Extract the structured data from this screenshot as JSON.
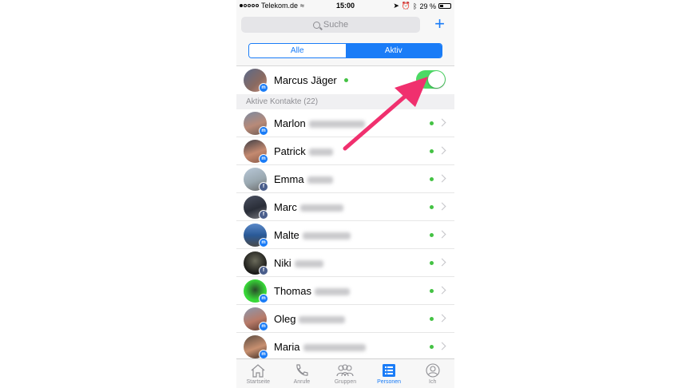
{
  "status_bar": {
    "carrier": "Telekom.de",
    "time": "15:00",
    "battery": "29 %"
  },
  "search": {
    "placeholder": "Suche"
  },
  "segments": {
    "all": "Alle",
    "active": "Aktiv"
  },
  "own_profile": {
    "name": "Marcus Jäger",
    "active_toggle_on": true
  },
  "section_header": "Aktive Kontakte (22)",
  "contacts": [
    {
      "first_name": "Marlon",
      "badge": "messenger-icon"
    },
    {
      "first_name": "Patrick",
      "badge": "messenger-icon"
    },
    {
      "first_name": "Emma",
      "badge": "facebook-icon"
    },
    {
      "first_name": "Marc",
      "badge": "facebook-icon"
    },
    {
      "first_name": "Malte",
      "badge": "messenger-icon"
    },
    {
      "first_name": "Niki",
      "badge": "facebook-icon"
    },
    {
      "first_name": "Thomas",
      "badge": "messenger-icon"
    },
    {
      "first_name": "Oleg",
      "badge": "messenger-icon"
    },
    {
      "first_name": "Maria",
      "badge": "messenger-icon"
    }
  ],
  "tabs": [
    {
      "label": "Startseite",
      "icon": "home-icon"
    },
    {
      "label": "Anrufe",
      "icon": "phone-icon"
    },
    {
      "label": "Gruppen",
      "icon": "groups-icon"
    },
    {
      "label": "Personen",
      "icon": "people-list-icon"
    },
    {
      "label": "Ich",
      "icon": "profile-icon"
    }
  ],
  "colors": {
    "accent": "#1a7cf7",
    "online": "#44c244",
    "toggle_on": "#4cd964",
    "annotation_arrow": "#f0306e"
  }
}
